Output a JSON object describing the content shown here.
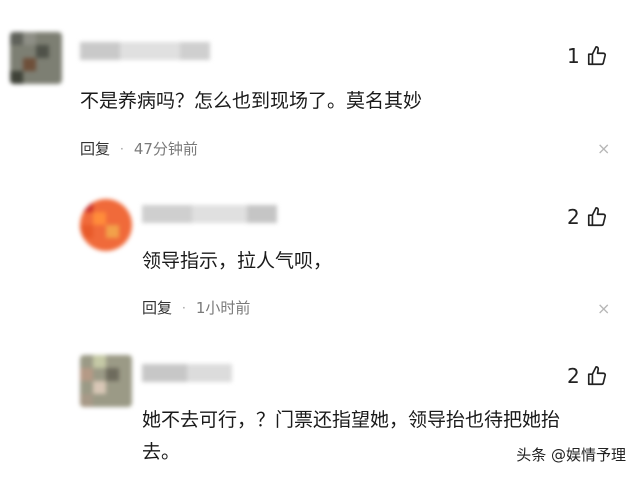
{
  "comments": [
    {
      "likes": "1",
      "text": "不是养病吗？怎么也到现场了。莫名其妙",
      "reply_label": "回复",
      "dot": "·",
      "time": "47分钟前",
      "close": "×"
    },
    {
      "likes": "2",
      "text": "领导指示，拉人气呗，",
      "reply_label": "回复",
      "dot": "·",
      "time": "1小时前",
      "close": "×"
    },
    {
      "likes": "2",
      "text_line1": "她不去可行，？门票还指望她，领导抬也待把她抬",
      "text_line2": "去。"
    }
  ],
  "watermark": "头条 @娱情予理",
  "icons": {
    "like": "thumbs-up-icon",
    "close": "close-icon"
  }
}
